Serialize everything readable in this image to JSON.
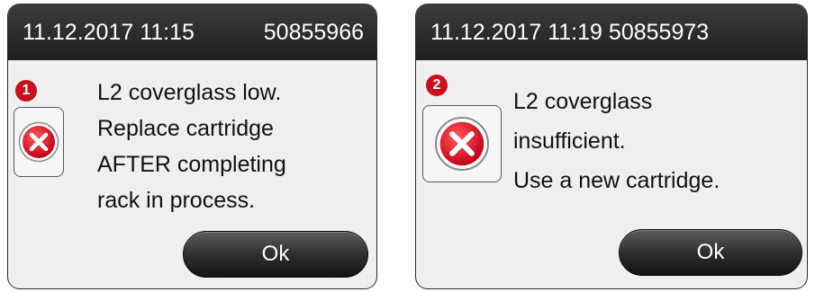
{
  "dialogs": [
    {
      "datetime": "11.12.2017 11:15",
      "code": "50855966",
      "badge": "1",
      "icon": "error-x-icon",
      "message_lines": [
        "L2 coverglass low.",
        "Replace cartridge",
        "AFTER completing",
        "rack in process."
      ],
      "ok_label": "Ok"
    },
    {
      "datetime": "11.12.2017 11:19",
      "code": "50855973",
      "badge": "2",
      "icon": "error-x-icon",
      "message_lines": [
        "L2 coverglass",
        "insufficient.",
        "Use a new cartridge."
      ],
      "ok_label": "Ok"
    }
  ],
  "colors": {
    "titlebar": "#2b2b2b",
    "dialog_background": "#efefef",
    "badge": "#c8101e",
    "error_icon": "#e0142a",
    "button": "#2b2b2b"
  }
}
